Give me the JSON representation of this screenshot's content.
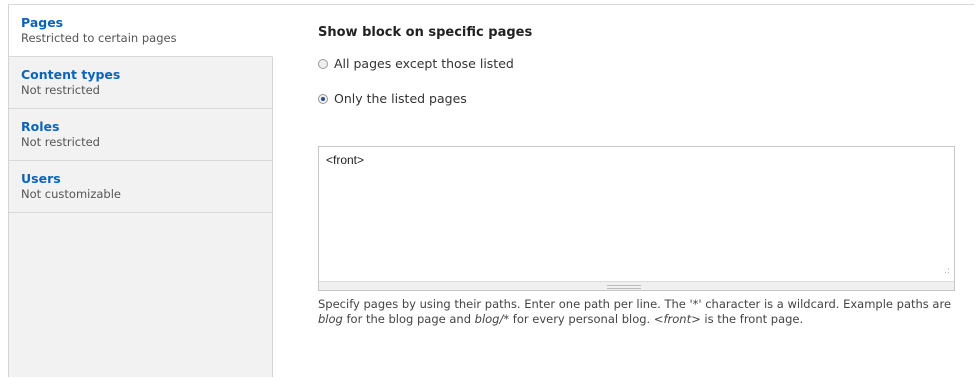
{
  "tabs": [
    {
      "title": "Pages",
      "summary": "Restricted to certain pages"
    },
    {
      "title": "Content types",
      "summary": "Not restricted"
    },
    {
      "title": "Roles",
      "summary": "Not restricted"
    },
    {
      "title": "Users",
      "summary": "Not customizable"
    }
  ],
  "pane": {
    "title": "Show block on specific pages",
    "options": [
      {
        "label": "All pages except those listed",
        "checked": false
      },
      {
        "label": "Only the listed pages",
        "checked": true
      }
    ],
    "textarea_value": "<front>",
    "description": {
      "part1": "Specify pages by using their paths. Enter one path per line. The '*' character is a wildcard. Example paths are ",
      "em1": "blog",
      "part2": " for the blog page and ",
      "em2": "blog/*",
      "part3": " for every personal blog. ",
      "em3": "<front>",
      "part4": " is the front page."
    }
  }
}
